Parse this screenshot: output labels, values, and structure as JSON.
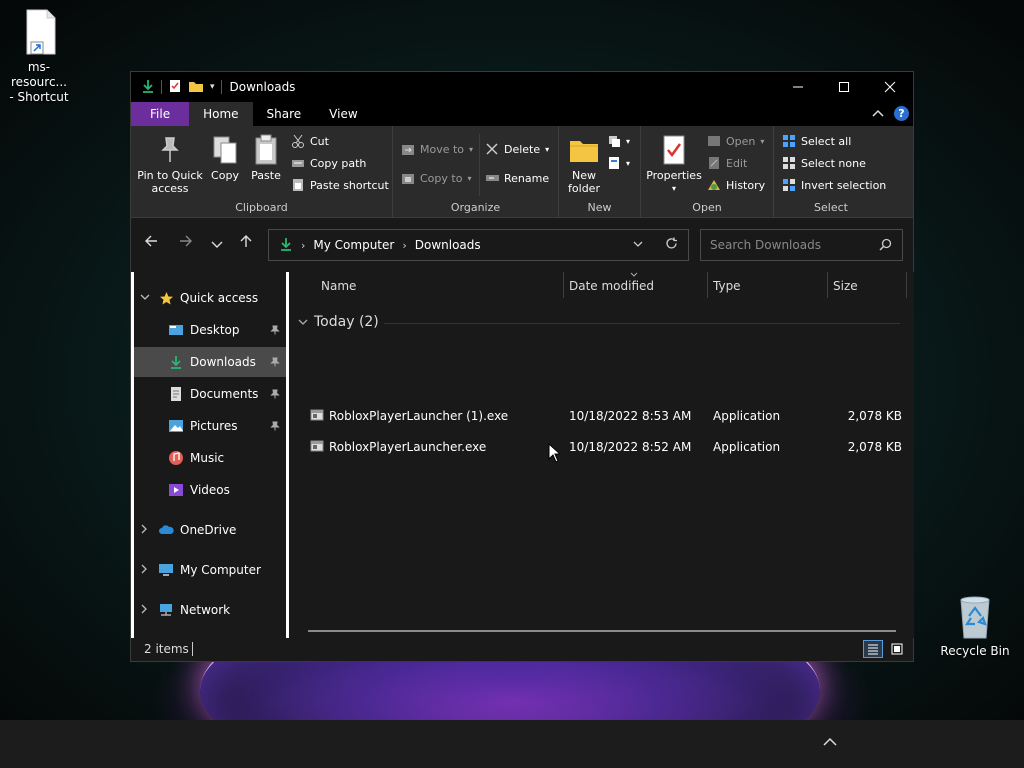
{
  "desktop": {
    "shortcut_label_line1": "ms-resourc...",
    "shortcut_label_line2": "- Shortcut",
    "recycle_bin_label": "Recycle Bin"
  },
  "window": {
    "title": "Downloads",
    "tabs": {
      "file": "File",
      "home": "Home",
      "share": "Share",
      "view": "View"
    },
    "ribbon": {
      "clipboard": {
        "pin_line1": "Pin to Quick",
        "pin_line2": "access",
        "copy": "Copy",
        "paste": "Paste",
        "cut": "Cut",
        "copy_path": "Copy path",
        "paste_shortcut": "Paste shortcut",
        "label": "Clipboard"
      },
      "organize": {
        "move_to": "Move to",
        "copy_to": "Copy to",
        "delete": "Delete",
        "rename": "Rename",
        "label": "Organize"
      },
      "new": {
        "new_folder_line1": "New",
        "new_folder_line2": "folder",
        "label": "New"
      },
      "open": {
        "properties": "Properties",
        "open": "Open",
        "edit": "Edit",
        "history": "History",
        "label": "Open"
      },
      "select": {
        "select_all": "Select all",
        "select_none": "Select none",
        "invert_selection": "Invert selection",
        "label": "Select"
      }
    },
    "address": {
      "crumbs": [
        "My Computer",
        "Downloads"
      ],
      "search_placeholder": "Search Downloads"
    },
    "nav": {
      "quick_access": "Quick access",
      "desktop": "Desktop",
      "downloads": "Downloads",
      "documents": "Documents",
      "pictures": "Pictures",
      "music": "Music",
      "videos": "Videos",
      "onedrive": "OneDrive",
      "my_computer": "My Computer",
      "network": "Network"
    },
    "columns": {
      "name": "Name",
      "date_modified": "Date modified",
      "type": "Type",
      "size": "Size"
    },
    "group_header": "Today (2)",
    "files": [
      {
        "name": "RobloxPlayerLauncher (1).exe",
        "date": "10/18/2022 8:53 AM",
        "type": "Application",
        "size": "2,078 KB"
      },
      {
        "name": "RobloxPlayerLauncher.exe",
        "date": "10/18/2022 8:52 AM",
        "type": "Application",
        "size": "2,078 KB"
      }
    ],
    "status": "2 items"
  }
}
